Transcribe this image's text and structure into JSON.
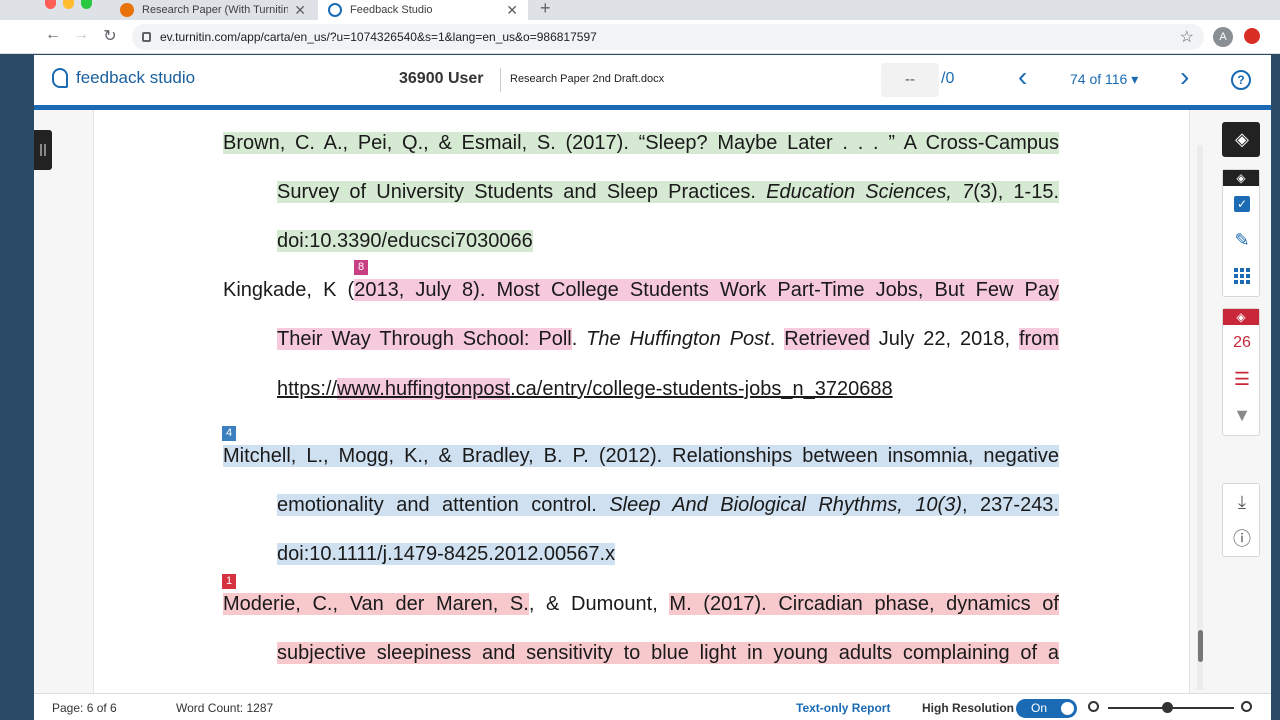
{
  "browser": {
    "tabs": [
      {
        "title": "Research Paper (With Turnitin) -",
        "favicon_color": "#e8710a"
      },
      {
        "title": "Feedback Studio",
        "favicon_color": "#1a6ab4"
      }
    ],
    "url": "ev.turnitin.com/app/carta/en_us/?u=1074326540&s=1&lang=en_us&o=986817597",
    "avatar_letter": "A"
  },
  "header": {
    "logo_text": "feedback studio",
    "user_name": "36900 User",
    "document_name": "Research Paper 2nd Draft.docx",
    "score": "--",
    "score_total": "/0",
    "page_indicator": "74 of 116 ▾"
  },
  "document": {
    "entries": [
      {
        "lines": [
          "Brown, C. A., Pei, Q., & Esmail, S. (2017). “Sleep? Maybe Later . . . ” A Cross-Campus",
          [
            "Survey of University Students and Sleep Practices. ",
            "Education Sciences, 7",
            "(3), 1-15."
          ],
          "doi:10.3390/educsci7030066"
        ]
      },
      {
        "badge": "8",
        "badge_color": "#c93f84",
        "lines": [
          [
            "Kingkade, K (",
            "2013, July 8). Most College Students Work Part-Time Jobs, But Few Pay"
          ],
          [
            "Their Way Through School: Poll",
            ". ",
            "The Huffington Post",
            ". ",
            "Retrieved",
            " July 22, 2018, ",
            "from"
          ],
          [
            "https://",
            "www.huffingtonpost",
            ".ca/entry/college-students-jobs_n_3720688"
          ]
        ]
      },
      {
        "badge": "4",
        "badge_color": "#3a7fbf",
        "lines": [
          "Mitchell, L., Mogg, K., & Bradley, B. P. (2012). Relationships between insomnia, negative",
          [
            "emotionality and attention control. ",
            "Sleep And Biological Rhythms, 10(3)",
            ", 237-243."
          ],
          "doi:10.1111/j.1479-8425.2012.00567.x"
        ]
      },
      {
        "badge": "1",
        "badge_color": "#d6323f",
        "lines": [
          [
            "Moderie, C., Van der Maren, S.",
            ", & Dumount, ",
            "M. (2017). Circadian phase, dynamics of"
          ],
          "subjective sleepiness and sensitivity to blue light in young adults complaining of a"
        ]
      }
    ]
  },
  "sidebar": {
    "similarity_count": "26"
  },
  "footer": {
    "page": "Page: 6 of 6",
    "word_count": "Word Count: 1287",
    "text_only": "Text-only Report",
    "high_res": "High Resolution",
    "toggle": "On"
  },
  "colors": {
    "brand_blue": "#1a6ab4",
    "match_green": "#d6ead3",
    "match_pink": "#f6c9dd",
    "match_blue": "#cfe0f0",
    "match_red": "#f7c9cc"
  }
}
